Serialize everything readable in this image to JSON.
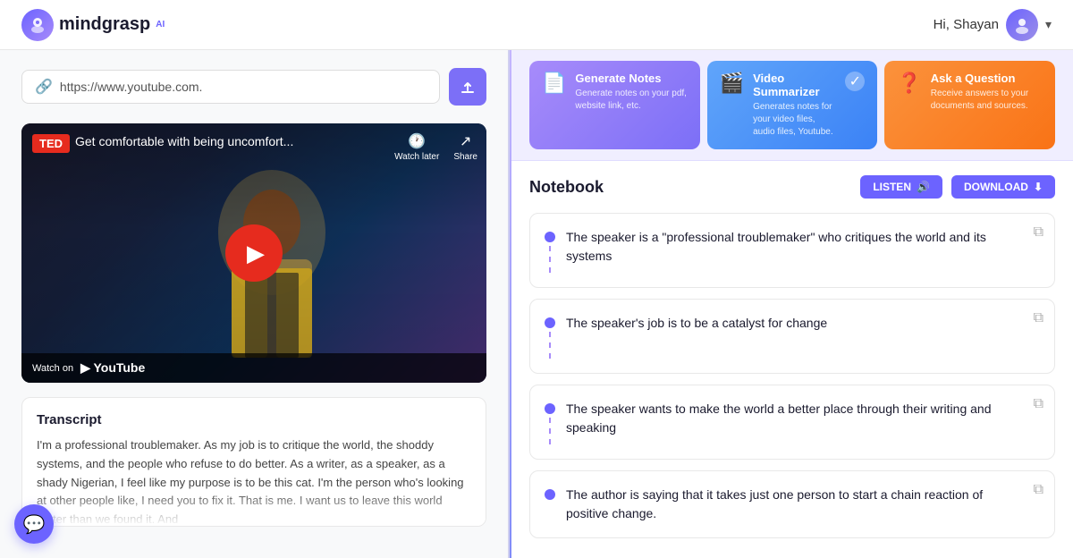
{
  "header": {
    "logo_text": "mindgrasp",
    "logo_super": "AI",
    "greeting": "Hi, Shayan"
  },
  "url_bar": {
    "url_value": "https://www.youtube.com.",
    "url_placeholder": "https://www.youtube.com."
  },
  "video": {
    "ted_badge": "TED",
    "title": "Get comfortable with being uncomfort...",
    "watch_later": "Watch later",
    "share": "Share",
    "watch_on": "Watch on",
    "youtube": "▶ YouTube"
  },
  "transcript": {
    "title": "Transcript",
    "text": "I'm a professional troublemaker. As my job is to critique the world, the shoddy systems, and the people who refuse to do better. As a writer, as a speaker, as a shady Nigerian, I feel like my purpose is to be this cat. I'm the person who's looking at other people like, I need you to fix it. That is me. I want us to leave this world better than we found it. And"
  },
  "feature_cards": [
    {
      "id": "generate",
      "title": "Generate Notes",
      "desc": "Generate notes on your pdf, website link, etc.",
      "icon": "📄",
      "has_check": false
    },
    {
      "id": "video",
      "title": "Video Summarizer",
      "desc": "Generates notes for your video files, audio files, Youtube.",
      "icon": "🎬",
      "has_check": true
    },
    {
      "id": "ask",
      "title": "Ask a Question",
      "desc": "Receive answers to your documents and sources.",
      "icon": "❓",
      "has_check": false
    }
  ],
  "notebook": {
    "title": "Notebook",
    "listen_label": "LISTEN",
    "download_label": "DOWNLOAD",
    "notes": [
      {
        "id": 1,
        "text": "The speaker is a \"professional troublemaker\" who critiques the world and its systems"
      },
      {
        "id": 2,
        "text": "The speaker's job is to be a catalyst for change"
      },
      {
        "id": 3,
        "text": "The speaker wants to make the world a better place through their writing and speaking"
      },
      {
        "id": 4,
        "text": "The author is saying that it takes just one person to start a chain reaction of positive change."
      }
    ]
  },
  "chat_button": {
    "icon": "💬"
  }
}
